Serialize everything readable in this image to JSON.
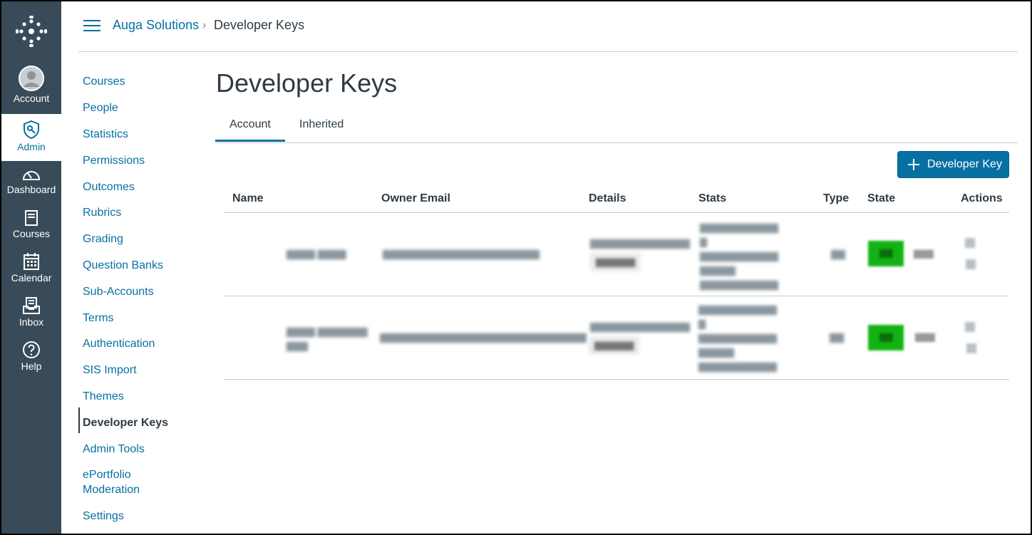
{
  "nav": {
    "items": [
      {
        "label": "Account",
        "icon": "account-avatar-icon"
      },
      {
        "label": "Admin",
        "icon": "admin-shield-icon",
        "active": true
      },
      {
        "label": "Dashboard",
        "icon": "dashboard-icon"
      },
      {
        "label": "Courses",
        "icon": "courses-icon"
      },
      {
        "label": "Calendar",
        "icon": "calendar-icon"
      },
      {
        "label": "Inbox",
        "icon": "inbox-icon"
      },
      {
        "label": "Help",
        "icon": "help-icon"
      }
    ]
  },
  "breadcrumb": {
    "root": "Auga Solutions",
    "separator": "›",
    "current": "Developer Keys"
  },
  "sidebar": {
    "items": [
      {
        "label": "Courses"
      },
      {
        "label": "People"
      },
      {
        "label": "Statistics"
      },
      {
        "label": "Permissions"
      },
      {
        "label": "Outcomes"
      },
      {
        "label": "Rubrics"
      },
      {
        "label": "Grading"
      },
      {
        "label": "Question Banks"
      },
      {
        "label": "Sub-Accounts"
      },
      {
        "label": "Terms"
      },
      {
        "label": "Authentication"
      },
      {
        "label": "SIS Import"
      },
      {
        "label": "Themes"
      },
      {
        "label": "Developer Keys",
        "active": true
      },
      {
        "label": "Admin Tools"
      },
      {
        "label": "ePortfolio Moderation"
      },
      {
        "label": "Settings"
      }
    ]
  },
  "page": {
    "title": "Developer Keys",
    "tabs": [
      {
        "label": "Account"
      },
      {
        "label": "Inherited"
      }
    ],
    "add_button": "Developer Key"
  },
  "table": {
    "headers": [
      "Name",
      "Owner Email",
      "Details",
      "Stats",
      "Type",
      "State",
      "Actions"
    ]
  },
  "colors": {
    "nav_bg": "#394b58",
    "brand": "#0770a3",
    "on_green": "#13b213"
  }
}
